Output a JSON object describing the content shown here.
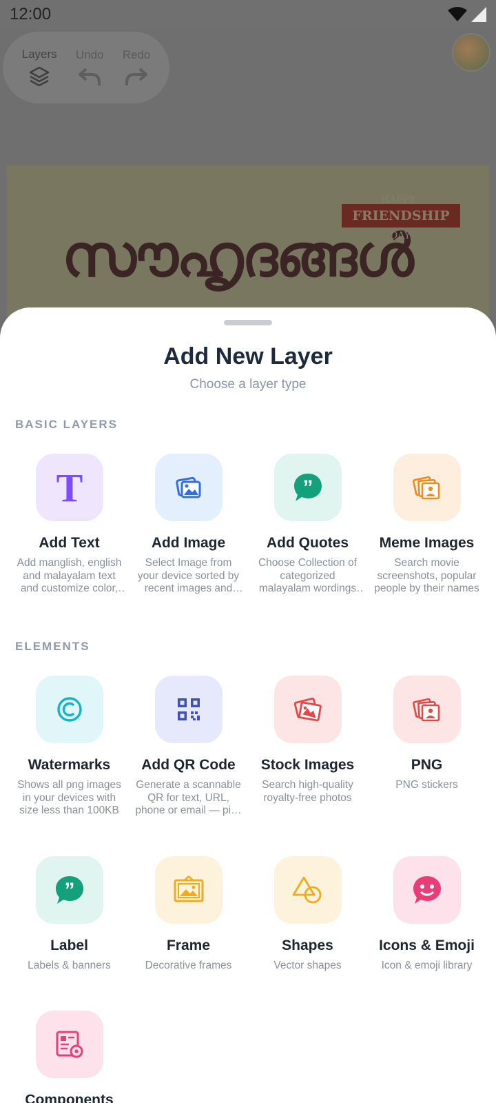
{
  "status_bar": {
    "time": "12:00"
  },
  "toolbar": {
    "layers_label": "Layers",
    "undo_label": "Undo",
    "redo_label": "Redo"
  },
  "canvas": {
    "title_text": "സൗഹൃദങ്ങൾ",
    "banner_top": "HAPPY",
    "banner_main": "FRIENDSHIP",
    "banner_bottom": "DAY"
  },
  "sheet": {
    "title": "Add New Layer",
    "subtitle": "Choose a layer type",
    "basic_section": "BASIC LAYERS",
    "elements_section": "ELEMENTS",
    "basic_layers": [
      {
        "name": "Add Text",
        "desc": "Add manglish, english and malayalam text and customize color, fonts and more",
        "icon": "text-icon",
        "bg": "#efe6fd",
        "fg": "#7c4dff"
      },
      {
        "name": "Add Image",
        "desc": "Select Image from your device sorted by recent images and folders",
        "icon": "image-icon",
        "bg": "#e3effd",
        "fg": "#2f6fe0"
      },
      {
        "name": "Add Quotes",
        "desc": "Choose Collection of categorized malayalam wordings and quotes",
        "icon": "quote-bubble-icon",
        "bg": "#e0f5ef",
        "fg": "#13a07a"
      },
      {
        "name": "Meme Images",
        "desc": "Search movie screenshots, popular people by their names",
        "icon": "meme-images-icon",
        "bg": "#fdeedd",
        "fg": "#f08a1c"
      }
    ],
    "elements": [
      {
        "name": "Watermarks",
        "desc": "Shows all png images in your devices with size less than 100KB",
        "icon": "copyright-icon",
        "bg": "#e0f6f8",
        "fg": "#14b5c2"
      },
      {
        "name": "Add QR Code",
        "desc": "Generate a scannable QR for text, URL, phone or email — pick a style",
        "icon": "qr-code-icon",
        "bg": "#e6e9fb",
        "fg": "#3f51b5"
      },
      {
        "name": "Stock Images",
        "desc": "Search high-quality royalty-free photos",
        "icon": "stock-images-icon",
        "bg": "#fde5e5",
        "fg": "#e34848"
      },
      {
        "name": "PNG",
        "desc": "PNG stickers",
        "icon": "png-sticker-icon",
        "bg": "#fde5e5",
        "fg": "#e34848"
      },
      {
        "name": "Label",
        "desc": "Labels & banners",
        "icon": "label-bubble-icon",
        "bg": "#e0f5ef",
        "fg": "#13a07a"
      },
      {
        "name": "Frame",
        "desc": "Decorative frames",
        "icon": "frame-icon",
        "bg": "#fdf3dc",
        "fg": "#f2ab1b"
      },
      {
        "name": "Shapes",
        "desc": "Vector shapes",
        "icon": "shapes-icon",
        "bg": "#fdf3dc",
        "fg": "#f2ab1b"
      },
      {
        "name": "Icons & Emoji",
        "desc": "Icon & emoji library",
        "icon": "emoji-icon",
        "bg": "#fde2ec",
        "fg": "#e83e78"
      },
      {
        "name": "Components",
        "desc": "",
        "icon": "components-icon",
        "bg": "#fde2ec",
        "fg": "#e83e78"
      }
    ]
  }
}
